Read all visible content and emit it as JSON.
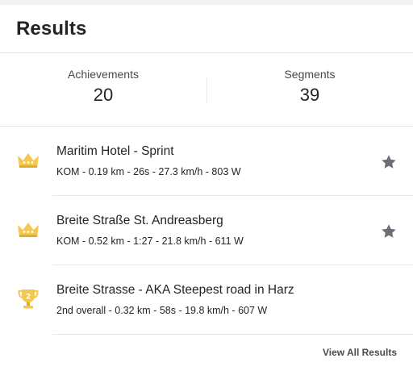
{
  "header": {
    "title": "Results"
  },
  "stats": {
    "achievements_label": "Achievements",
    "achievements_value": "20",
    "segments_label": "Segments",
    "segments_value": "39"
  },
  "results": [
    {
      "icon": "crown-icon",
      "title": "Maritim Hotel - Sprint",
      "details": "KOM - 0.19 km - 26s - 27.3 km/h - 803 W",
      "starred": true
    },
    {
      "icon": "crown-icon",
      "title": "Breite Straße St. Andreasberg",
      "details": "KOM - 0.52 km - 1:27 - 21.8 km/h - 611 W",
      "starred": true
    },
    {
      "icon": "trophy-icon",
      "trophy_rank": "2",
      "title": "Breite Strasse - AKA Steepest road in Harz",
      "details": "2nd overall - 0.32 km - 58s - 19.8 km/h - 607 W",
      "starred": false
    }
  ],
  "footer": {
    "view_all_label": "View All Results"
  },
  "colors": {
    "gold": "#f5c84c",
    "gold_dark": "#e0ae2c",
    "star": "#6d6d78",
    "divider": "#e6e6eb",
    "text": "#242428"
  }
}
